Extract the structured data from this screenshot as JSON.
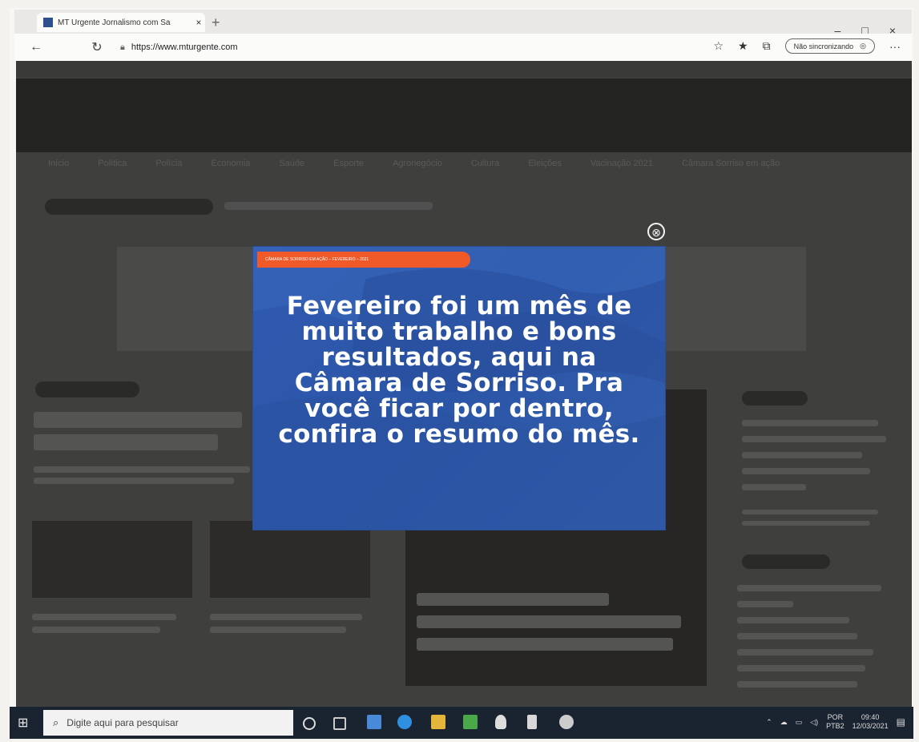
{
  "browser": {
    "tab_title": "MT Urgente Jornalismo com Sa",
    "tab_close": "×",
    "new_tab": "+",
    "url": "https://www.mturgente.com",
    "nav_pill": "Não sincronizando",
    "back": "←",
    "reload": "↻",
    "more": "···",
    "win_min": "–",
    "win_max": "□",
    "win_close": "×"
  },
  "site": {
    "menu": [
      "Início",
      "Política",
      "Polícia",
      "Economia",
      "Saúde",
      "Esporte",
      "Agronegócio",
      "Cultura",
      "Eleições",
      "Vacinação 2021",
      "Câmara Sorriso em ação"
    ]
  },
  "popup": {
    "ribbon": "CÂMARA DE SORRISO EM AÇÃO – FEVEREIRO – 2021",
    "message": "Fevereiro foi um mês de muito trabalho e bons resultados, aqui na Câmara de Sorriso. Pra você ficar por dentro, confira o resumo do mês.",
    "close_glyph": "⊗"
  },
  "taskbar": {
    "search_placeholder": "Digite aqui para pesquisar",
    "lang": "POR",
    "lang2": "PTB2",
    "time": "09:40",
    "date": "12/03/2021",
    "start_glyph": "⊞"
  },
  "colors": {
    "popup_bg": "#2f5ab0",
    "ribbon": "#f05a28",
    "taskbar": "#1a2330"
  }
}
